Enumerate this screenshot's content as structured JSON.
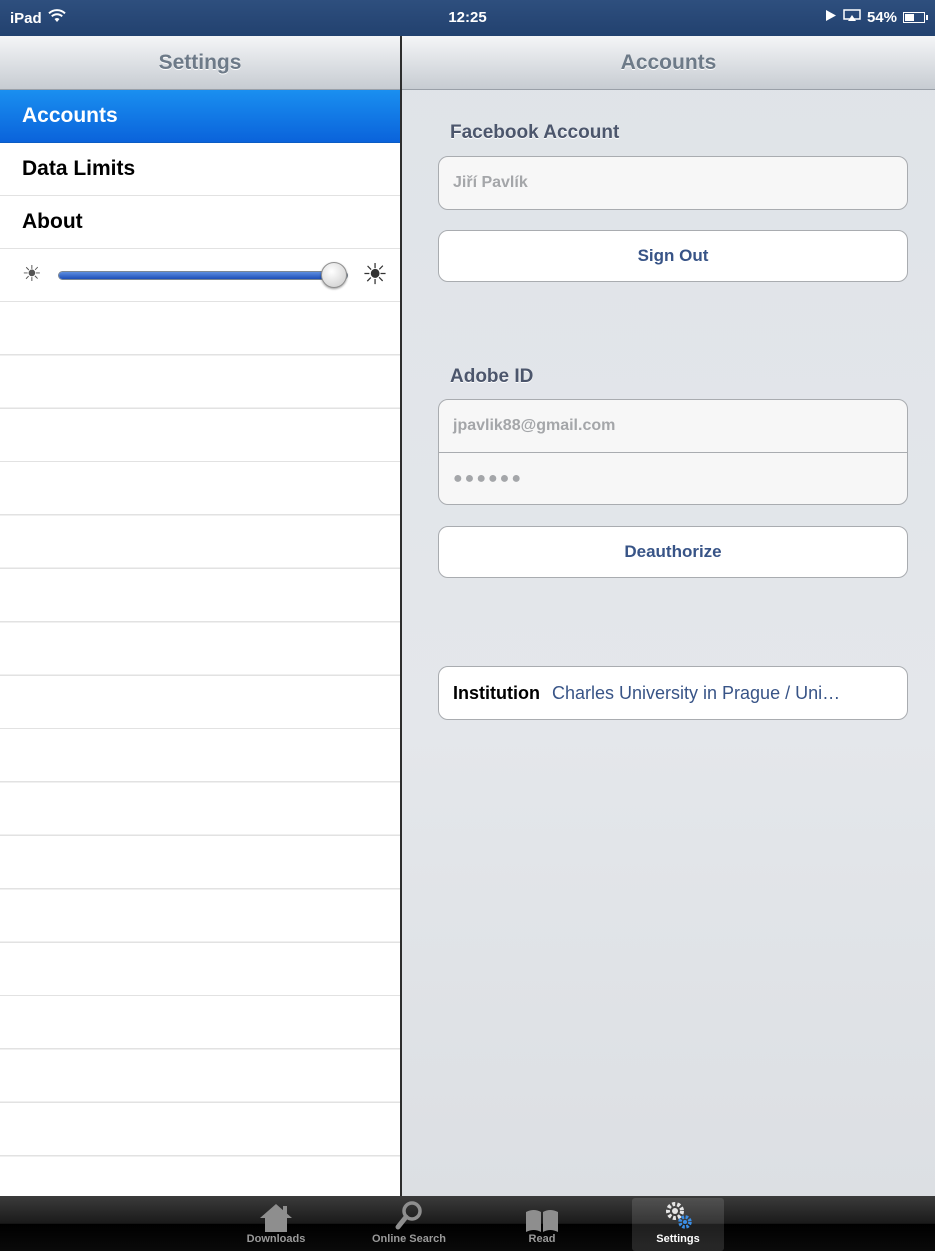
{
  "status_bar": {
    "device": "iPad",
    "time": "12:25",
    "battery_percent": "54%",
    "battery_level": 0.54,
    "icons": [
      "wifi-icon",
      "play-icon",
      "airplay-icon",
      "battery-icon"
    ]
  },
  "master": {
    "title": "Settings",
    "items": [
      {
        "label": "Accounts",
        "selected": true
      },
      {
        "label": "Data Limits",
        "selected": false
      },
      {
        "label": "About",
        "selected": false
      }
    ],
    "brightness": {
      "level": 0.95,
      "icons": [
        "brightness-low-icon",
        "brightness-high-icon"
      ]
    }
  },
  "detail": {
    "title": "Accounts",
    "facebook": {
      "header": "Facebook Account",
      "name": "Jiří Pavlík",
      "button": "Sign Out"
    },
    "adobe": {
      "header": "Adobe ID",
      "email": "jpavlik88@gmail.com",
      "password": "●●●●●●",
      "button": "Deauthorize"
    },
    "institution": {
      "label": "Institution",
      "value": "Charles University in Prague / Uni…"
    }
  },
  "tabbar": {
    "tabs": [
      {
        "label": "Downloads",
        "icon": "house-icon",
        "active": false
      },
      {
        "label": "Online Search",
        "icon": "magnifier-icon",
        "active": false
      },
      {
        "label": "Read",
        "icon": "book-icon",
        "active": false
      },
      {
        "label": "Settings",
        "icon": "gears-icon",
        "active": true
      }
    ]
  },
  "colors": {
    "status_bar": "#22416f",
    "selection": "#0a63db",
    "link_text": "#385487",
    "detail_background": "#e2e5e9",
    "tabbar": "#111111"
  }
}
